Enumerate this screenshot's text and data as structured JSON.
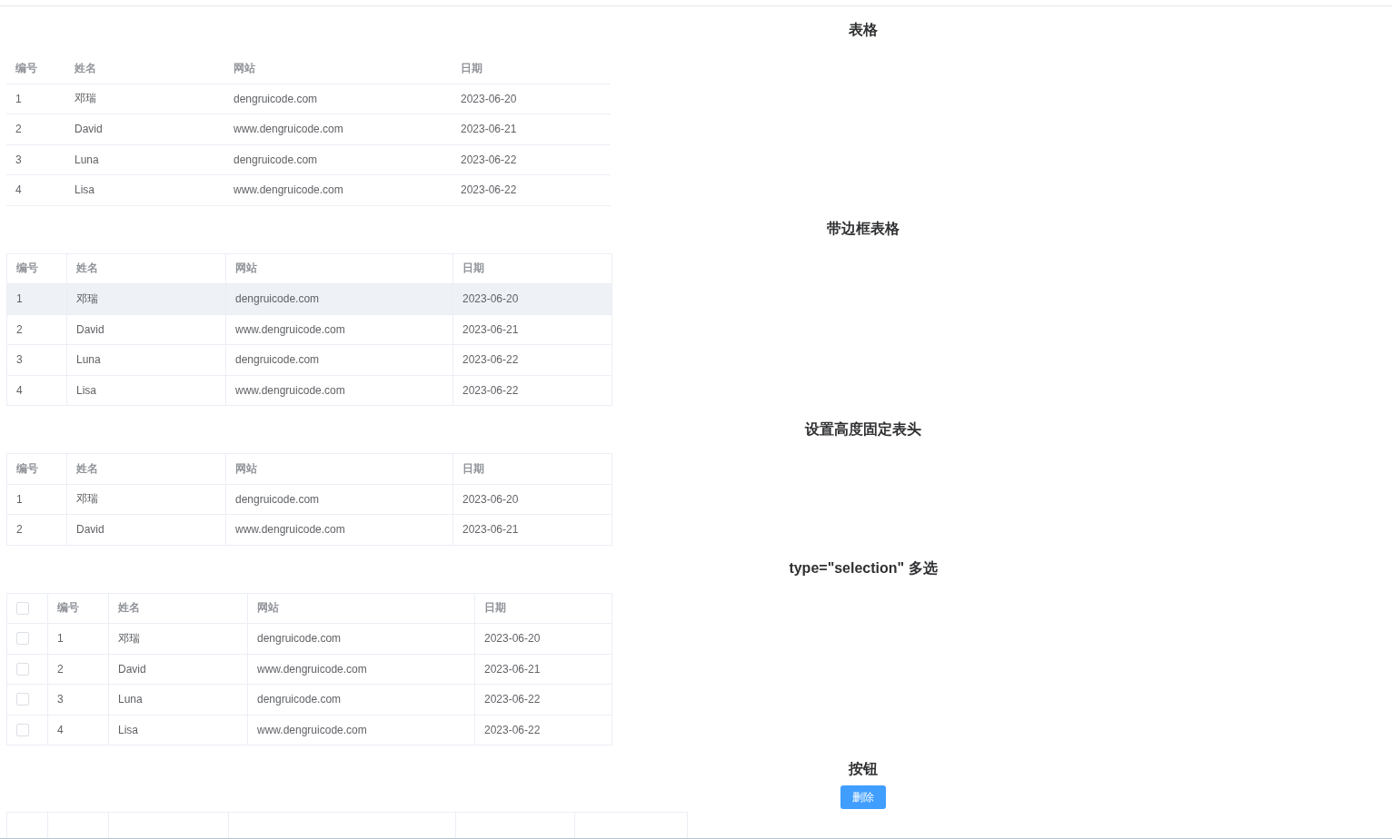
{
  "sections": [
    {
      "title": "表格",
      "table": {
        "kind": "plain",
        "columns": [
          "编号",
          "姓名",
          "网站",
          "日期"
        ],
        "rows": [
          {
            "highlighted": false,
            "cells": [
              "1",
              "邓瑞",
              "dengruicode.com",
              "2023-06-20"
            ]
          },
          {
            "highlighted": false,
            "cells": [
              "2",
              "David",
              "www.dengruicode.com",
              "2023-06-21"
            ]
          },
          {
            "highlighted": false,
            "cells": [
              "3",
              "Luna",
              "dengruicode.com",
              "2023-06-22"
            ]
          },
          {
            "highlighted": false,
            "cells": [
              "4",
              "Lisa",
              "www.dengruicode.com",
              "2023-06-22"
            ]
          }
        ]
      }
    },
    {
      "title": "带边框表格",
      "table": {
        "kind": "bordered",
        "columns": [
          "编号",
          "姓名",
          "网站",
          "日期"
        ],
        "rows": [
          {
            "highlighted": true,
            "cells": [
              "1",
              "邓瑞",
              "dengruicode.com",
              "2023-06-20"
            ]
          },
          {
            "highlighted": false,
            "cells": [
              "2",
              "David",
              "www.dengruicode.com",
              "2023-06-21"
            ]
          },
          {
            "highlighted": false,
            "cells": [
              "3",
              "Luna",
              "dengruicode.com",
              "2023-06-22"
            ]
          },
          {
            "highlighted": false,
            "cells": [
              "4",
              "Lisa",
              "www.dengruicode.com",
              "2023-06-22"
            ]
          }
        ]
      }
    },
    {
      "title": "设置高度固定表头",
      "table": {
        "kind": "bordered",
        "columns": [
          "编号",
          "姓名",
          "网站",
          "日期"
        ],
        "rows": [
          {
            "highlighted": false,
            "cells": [
              "1",
              "邓瑞",
              "dengruicode.com",
              "2023-06-20"
            ]
          },
          {
            "highlighted": false,
            "cells": [
              "2",
              "David",
              "www.dengruicode.com",
              "2023-06-21"
            ]
          }
        ]
      }
    },
    {
      "title": "type=\"selection\" 多选",
      "table": {
        "kind": "selection",
        "header_checked": false,
        "columns": [
          "编号",
          "姓名",
          "网站",
          "日期"
        ],
        "rows": [
          {
            "highlighted": false,
            "checked": false,
            "cells": [
              "1",
              "邓瑞",
              "dengruicode.com",
              "2023-06-20"
            ]
          },
          {
            "highlighted": false,
            "checked": false,
            "cells": [
              "2",
              "David",
              "www.dengruicode.com",
              "2023-06-21"
            ]
          },
          {
            "highlighted": false,
            "checked": false,
            "cells": [
              "3",
              "Luna",
              "dengruicode.com",
              "2023-06-22"
            ]
          },
          {
            "highlighted": false,
            "checked": false,
            "cells": [
              "4",
              "Lisa",
              "www.dengruicode.com",
              "2023-06-22"
            ]
          }
        ]
      }
    },
    {
      "title": "按钮",
      "button": {
        "label": "删除"
      }
    }
  ]
}
